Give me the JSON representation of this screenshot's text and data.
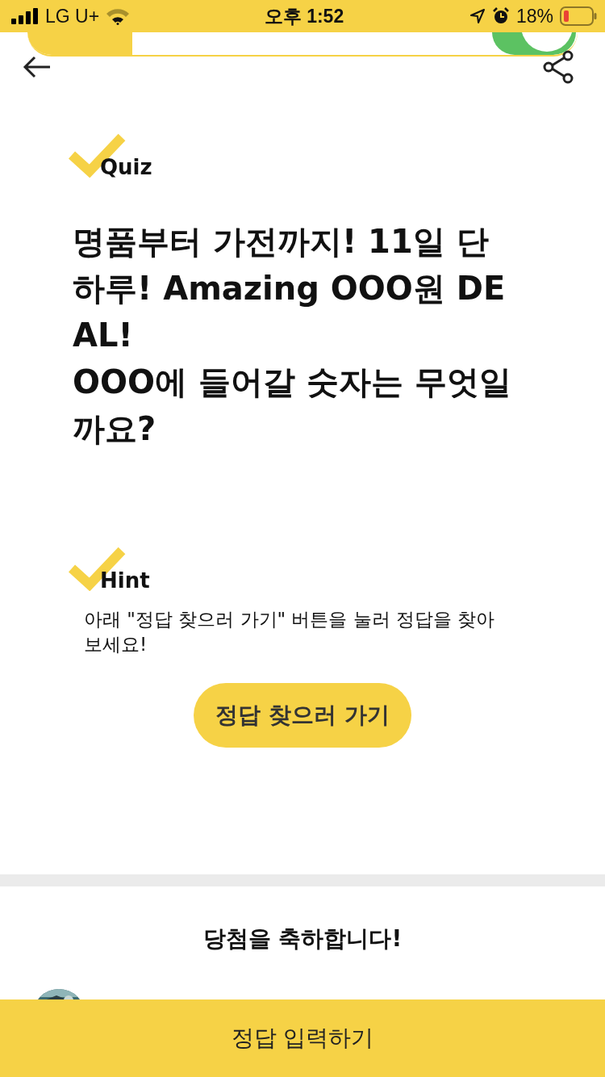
{
  "status_bar": {
    "carrier": "LG U+",
    "time": "오후 1:52",
    "battery": "18%"
  },
  "quiz": {
    "label": "Quiz",
    "question": "명품부터 가전까지! 11일 단 하루! Amazing OOO원 DEAL!\nOOO에 들어갈 숫자는 무엇일까요?"
  },
  "hint": {
    "label": "Hint",
    "text": " 아래 \"정답 찾으러 가기\" 버튼을 눌러 정답을 찾아보세요!",
    "button": "정답 찾으러 가기"
  },
  "winners": {
    "title": "당첨을 축하합니다!"
  },
  "bottom_button": "정답 입력하기"
}
